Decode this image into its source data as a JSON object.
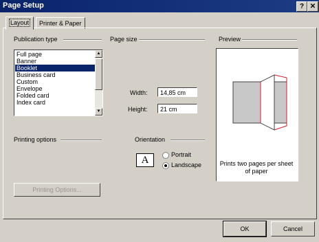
{
  "window": {
    "title": "Page Setup",
    "help_label": "?",
    "close_label": "✕"
  },
  "tabs": [
    {
      "label": "Layout"
    },
    {
      "label": "Printer & Paper"
    }
  ],
  "publication_type": {
    "heading": "Publication type",
    "items": [
      "Full page",
      "Banner",
      "Booklet",
      "Business card",
      "Custom",
      "Envelope",
      "Folded card",
      "Index card"
    ],
    "selected": "Booklet"
  },
  "page_size": {
    "heading": "Page size",
    "width_label": "Width:",
    "width_value": "14,85 cm",
    "height_label": "Height:",
    "height_value": "21 cm"
  },
  "printing_options": {
    "heading": "Printing options",
    "button_label": "Printing Options..."
  },
  "orientation": {
    "heading": "Orientation",
    "icon_glyph": "A",
    "portrait_label": "Portrait",
    "landscape_label": "Landscape",
    "selected": "Landscape"
  },
  "preview": {
    "heading": "Preview",
    "caption": "Prints two pages per sheet of paper"
  },
  "footer": {
    "ok_label": "OK",
    "cancel_label": "Cancel"
  },
  "colors": {
    "title_bar": "#0a246a",
    "dialog_face": "#d4d0c8",
    "selection": "#0a246a",
    "fold_line": "#cc2233"
  }
}
